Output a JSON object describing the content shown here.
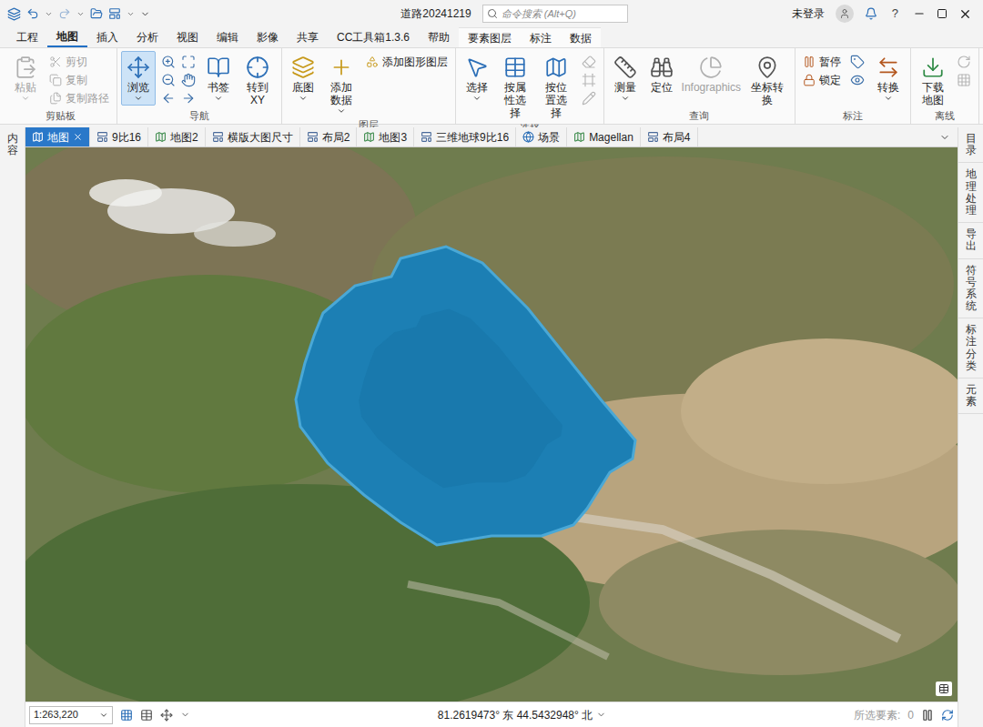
{
  "window": {
    "title": "道路20241219",
    "search_placeholder": "命令搜索 (Alt+Q)",
    "user": "未登录",
    "help": "?"
  },
  "ribbon_tabs": [
    {
      "label": "工程",
      "selected": false,
      "contextual": false
    },
    {
      "label": "地图",
      "selected": true,
      "contextual": false
    },
    {
      "label": "插入",
      "selected": false,
      "contextual": false
    },
    {
      "label": "分析",
      "selected": false,
      "contextual": false
    },
    {
      "label": "视图",
      "selected": false,
      "contextual": false
    },
    {
      "label": "编辑",
      "selected": false,
      "contextual": false
    },
    {
      "label": "影像",
      "selected": false,
      "contextual": false
    },
    {
      "label": "共享",
      "selected": false,
      "contextual": false
    },
    {
      "label": "CC工具箱1.3.6",
      "selected": false,
      "contextual": false
    },
    {
      "label": "帮助",
      "selected": false,
      "contextual": false
    },
    {
      "label": "要素图层",
      "selected": false,
      "contextual": true
    },
    {
      "label": "标注",
      "selected": false,
      "contextual": true
    },
    {
      "label": "数据",
      "selected": false,
      "contextual": true
    }
  ],
  "ribbon_groups": [
    {
      "label": "剪贴板",
      "buttons": [
        {
          "label": "粘贴",
          "kind": "large",
          "disabled": true,
          "selected": false,
          "menu": true
        },
        {
          "label": "剪切",
          "kind": "small",
          "disabled": true,
          "selected": false,
          "menu": false
        },
        {
          "label": "复制",
          "kind": "small",
          "disabled": true,
          "selected": false,
          "menu": false
        },
        {
          "label": "复制路径",
          "kind": "small",
          "disabled": true,
          "selected": false,
          "menu": false
        }
      ]
    },
    {
      "label": "导航",
      "buttons": [
        {
          "label": "浏览",
          "kind": "large",
          "disabled": false,
          "selected": true,
          "menu": true
        },
        {
          "label": "",
          "kind": "icons",
          "disabled": false,
          "selected": false,
          "menu": false
        },
        {
          "label": "书签",
          "kind": "large",
          "disabled": false,
          "selected": false,
          "menu": true
        },
        {
          "label": "转到 XY",
          "kind": "large",
          "disabled": false,
          "selected": false,
          "menu": false
        }
      ]
    },
    {
      "label": "图层",
      "buttons": [
        {
          "label": "底图",
          "kind": "large",
          "disabled": false,
          "selected": false,
          "menu": true
        },
        {
          "label": "添加数据",
          "kind": "large",
          "disabled": false,
          "selected": false,
          "menu": true
        },
        {
          "label": "添加图形图层",
          "kind": "small",
          "disabled": false,
          "selected": false,
          "menu": false
        }
      ]
    },
    {
      "label": "选择",
      "buttons": [
        {
          "label": "选择",
          "kind": "large",
          "disabled": false,
          "selected": false,
          "menu": true
        },
        {
          "label": "按属性选择",
          "kind": "large",
          "disabled": false,
          "selected": false,
          "menu": false
        },
        {
          "label": "按位置选择",
          "kind": "large",
          "disabled": false,
          "selected": false,
          "menu": false
        },
        {
          "label": "",
          "kind": "icons",
          "disabled": true,
          "selected": false,
          "menu": false
        }
      ]
    },
    {
      "label": "查询",
      "buttons": [
        {
          "label": "测量",
          "kind": "large",
          "disabled": false,
          "selected": false,
          "menu": true
        },
        {
          "label": "定位",
          "kind": "large",
          "disabled": false,
          "selected": false,
          "menu": false
        },
        {
          "label": "Infographics",
          "kind": "large",
          "disabled": true,
          "selected": false,
          "menu": false
        },
        {
          "label": "坐标转换",
          "kind": "large",
          "disabled": false,
          "selected": false,
          "menu": false
        }
      ]
    },
    {
      "label": "标注",
      "buttons": [
        {
          "label": "暂停",
          "kind": "small",
          "disabled": false,
          "selected": false,
          "menu": false
        },
        {
          "label": "锁定",
          "kind": "small",
          "disabled": false,
          "selected": false,
          "menu": false
        },
        {
          "label": "",
          "kind": "icons",
          "disabled": false,
          "selected": false,
          "menu": false
        },
        {
          "label": "转换",
          "kind": "large",
          "disabled": false,
          "selected": false,
          "menu": true
        }
      ]
    },
    {
      "label": "离线",
      "buttons": [
        {
          "label": "下载地图",
          "kind": "large",
          "disabled": false,
          "selected": false,
          "menu": false
        },
        {
          "label": "",
          "kind": "icons",
          "disabled": true,
          "selected": false,
          "menu": false
        }
      ]
    }
  ],
  "map_tabs": [
    {
      "label": "地图",
      "kind": "map",
      "selected": true
    },
    {
      "label": "9比16",
      "kind": "layout",
      "selected": false
    },
    {
      "label": "地图2",
      "kind": "map",
      "selected": false
    },
    {
      "label": "横版大图尺寸",
      "kind": "layout",
      "selected": false
    },
    {
      "label": "布局2",
      "kind": "layout",
      "selected": false
    },
    {
      "label": "地图3",
      "kind": "map",
      "selected": false
    },
    {
      "label": "三维地球9比16",
      "kind": "layout",
      "selected": false
    },
    {
      "label": "场景",
      "kind": "scene",
      "selected": false
    },
    {
      "label": "Magellan",
      "kind": "map",
      "selected": false
    },
    {
      "label": "布局4",
      "kind": "layout",
      "selected": false
    }
  ],
  "side_panels": {
    "left": [
      "内容"
    ],
    "right": [
      "目录",
      "地理处理",
      "导出",
      "符号系统",
      "标注分类",
      "元素"
    ]
  },
  "status_bar": {
    "scale": "1:263,220",
    "coordinates": "81.2619473° 东 44.5432948° 北",
    "selected_label": "所选要素:",
    "selected_count": "0"
  }
}
